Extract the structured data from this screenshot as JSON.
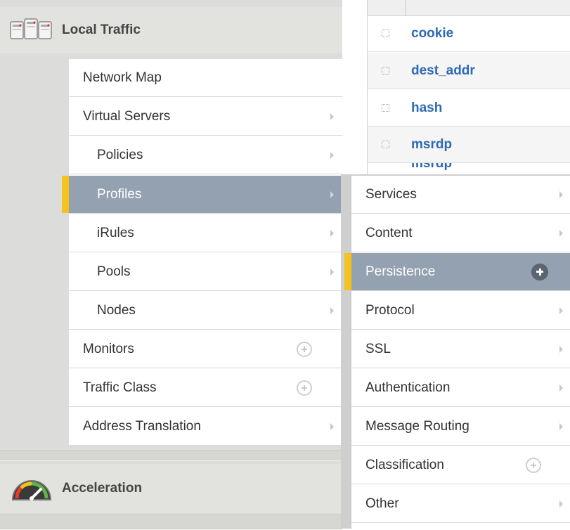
{
  "local_traffic": {
    "title": "Local Traffic",
    "icon": "servers-icon",
    "items": [
      {
        "label": "Network Map"
      },
      {
        "label": "Virtual Servers"
      },
      {
        "label": "Policies"
      },
      {
        "label": "Profiles"
      },
      {
        "label": "iRules"
      },
      {
        "label": "Pools"
      },
      {
        "label": "Nodes"
      },
      {
        "label": "Monitors"
      },
      {
        "label": "Traffic Class"
      },
      {
        "label": "Address Translation"
      }
    ]
  },
  "acceleration": {
    "title": "Acceleration",
    "icon": "speedometer-icon"
  },
  "profiles_flyout": {
    "items": [
      {
        "label": "Services"
      },
      {
        "label": "Content"
      },
      {
        "label": "Persistence"
      },
      {
        "label": "Protocol"
      },
      {
        "label": "SSL"
      },
      {
        "label": "Authentication"
      },
      {
        "label": "Message Routing"
      },
      {
        "label": "Classification"
      },
      {
        "label": "Other"
      }
    ]
  },
  "persistence_list": {
    "rows": [
      {
        "name": "cookie"
      },
      {
        "name": "dest_addr"
      },
      {
        "name": "hash"
      },
      {
        "name": "msrdp"
      },
      {
        "name": "msrdp"
      }
    ]
  },
  "colors": {
    "selected_bg": "#94a1b0",
    "accent": "#f5c21b",
    "link": "#2d69b6"
  }
}
